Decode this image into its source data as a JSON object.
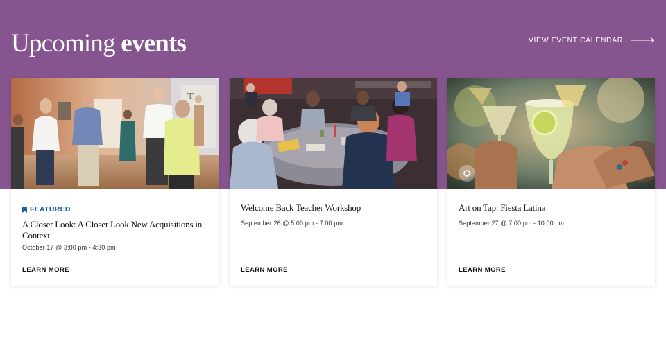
{
  "header": {
    "title_light": "Upcoming ",
    "title_bold": "events",
    "calendar_link": "VIEW EVENT CALENDAR"
  },
  "colors": {
    "band": "#86548f",
    "featured": "#1a5fa6"
  },
  "events": [
    {
      "badge": "FEATURED",
      "title": "A Closer Look: A Closer Look New Acquisitions in Context",
      "date": "October 17 @ 3:00 pm - 4:30 pm",
      "cta": "LEARN MORE"
    },
    {
      "title": "Welcome Back Teacher Workshop",
      "date": "September 26 @ 5:00 pm - 7:00 pm",
      "cta": "LEARN MORE"
    },
    {
      "title": "Art on Tap: Fiesta Latina",
      "date": "September 27 @ 7:00 pm - 10:00 pm",
      "cta": "LEARN MORE"
    }
  ]
}
